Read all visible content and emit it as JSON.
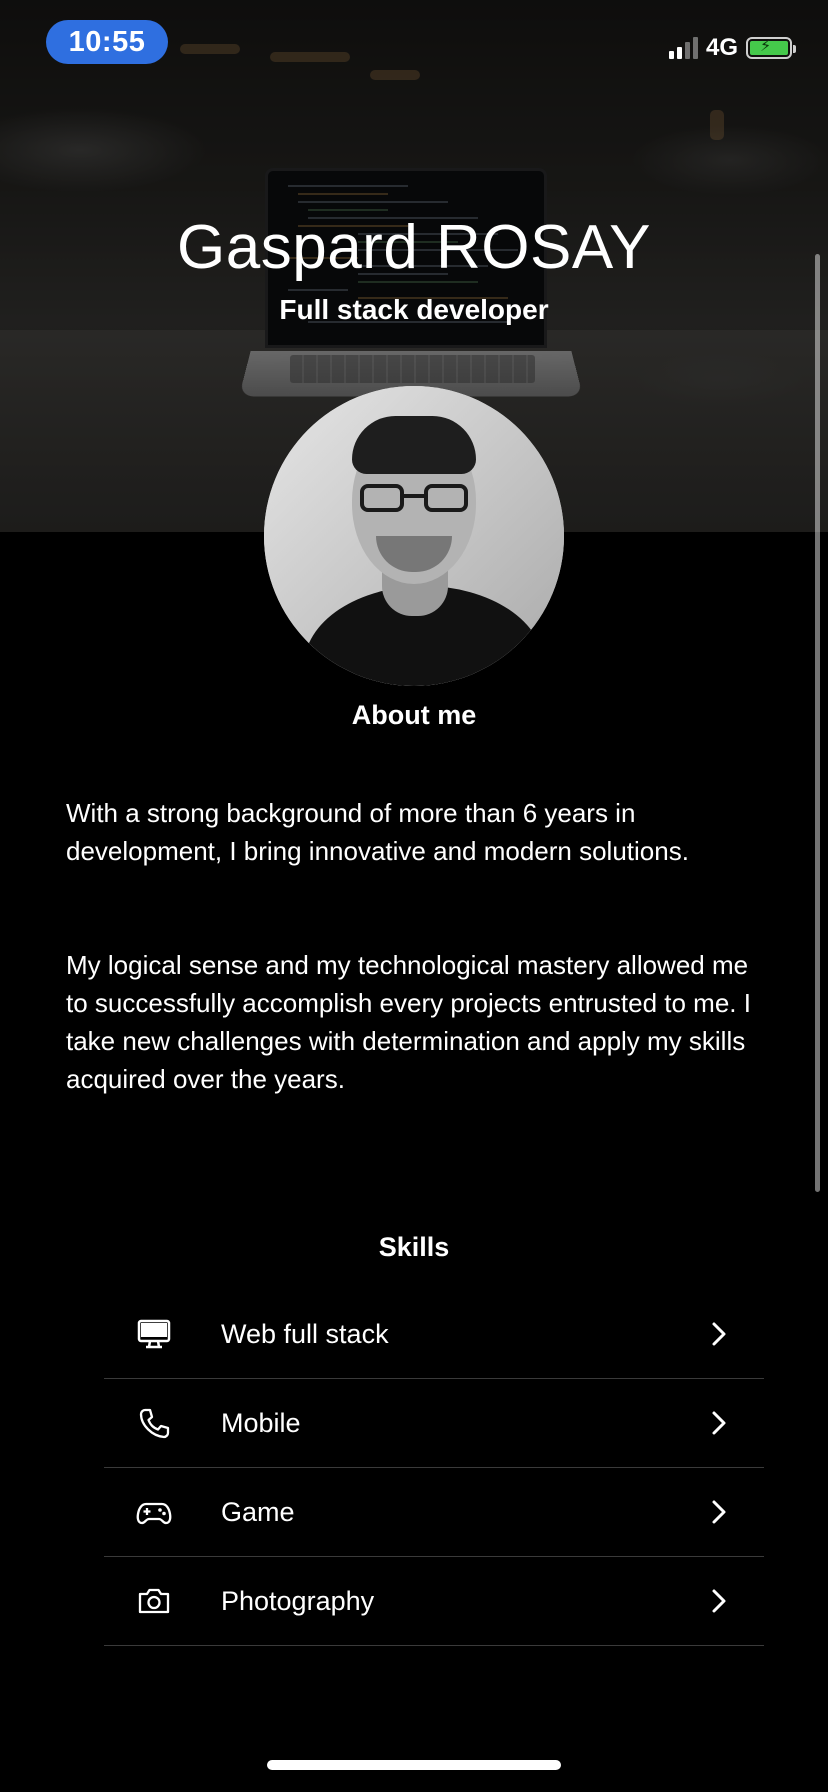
{
  "status_bar": {
    "time": "10:55",
    "network": "4G",
    "battery_charging": true,
    "accent_color": "#2f6fe0"
  },
  "profile": {
    "name": "Gaspard ROSAY",
    "role": "Full stack developer"
  },
  "about": {
    "heading": "About me",
    "paragraphs": [
      "With a strong background of more than 6 years in development, I bring innovative and modern solutions.",
      "My logical sense and my technological mastery allowed me to successfully accomplish every projects entrusted to me. I take new challenges with determination and apply my skills acquired over the years."
    ]
  },
  "skills": {
    "heading": "Skills",
    "items": [
      {
        "label": "Web full stack",
        "icon": "monitor-icon"
      },
      {
        "label": "Mobile",
        "icon": "phone-icon"
      },
      {
        "label": "Game",
        "icon": "gamepad-icon"
      },
      {
        "label": "Photography",
        "icon": "camera-icon"
      }
    ]
  }
}
